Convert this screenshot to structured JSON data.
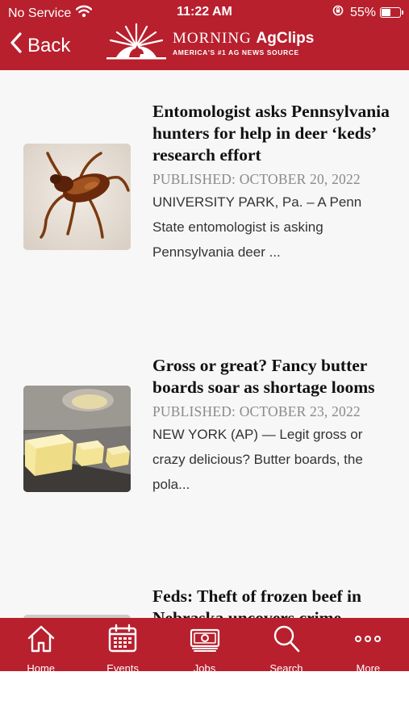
{
  "status_bar": {
    "carrier": "No Service",
    "time": "11:22 AM",
    "battery_percent": "55%",
    "battery_level": 0.55
  },
  "header": {
    "back_label": "Back",
    "logo_word1": "MORNING",
    "logo_word2": "AgClips",
    "logo_tagline": "AMERICA'S #1 AG NEWS SOURCE"
  },
  "articles": [
    {
      "title": "Entomologist asks Pennsylvania hunters for help in deer ‘keds’ research effort",
      "published": "PUBLISHED: OCTOBER 20, 2022",
      "excerpt": "UNIVERSITY PARK, Pa. – A Penn State entomologist is asking Pennsylvania deer ..."
    },
    {
      "title": "Gross or great? Fancy butter boards soar as shortage looms",
      "published": "PUBLISHED: OCTOBER 23, 2022",
      "excerpt": "NEW YORK (AP) — Legit gross or crazy delicious? Butter boards, the pola..."
    },
    {
      "title": "Feds: Theft of frozen beef in Nebraska uncovers crime"
    }
  ],
  "tabs": [
    {
      "label": "Home",
      "icon": "home-icon"
    },
    {
      "label": "Events",
      "icon": "calendar-icon"
    },
    {
      "label": "Jobs",
      "icon": "money-icon"
    },
    {
      "label": "Search",
      "icon": "search-icon"
    },
    {
      "label": "More",
      "icon": "more-icon"
    }
  ],
  "colors": {
    "brand_red": "#b8202e",
    "background": "#f7f7f7",
    "meta_gray": "#8a8a8a"
  }
}
